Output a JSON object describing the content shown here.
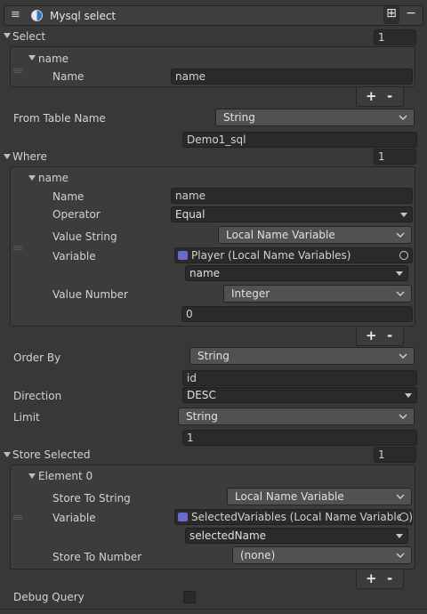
{
  "header": {
    "menu_icon": "≡",
    "title": "Mysql select",
    "add_icon": "⊞",
    "remove_icon": "−"
  },
  "select": {
    "label": "Select",
    "count": "1",
    "item": {
      "header": "name",
      "field_label": "Name",
      "field_value": "name"
    }
  },
  "from_table": {
    "label": "From Table Name",
    "type": "String",
    "value": "Demo1_sql"
  },
  "where": {
    "label": "Where",
    "count": "1",
    "item": {
      "header": "name",
      "name_label": "Name",
      "name_value": "name",
      "operator_label": "Operator",
      "operator_value": "Equal",
      "value_string_label": "Value String",
      "value_string_type": "Local Name Variable",
      "variable_label": "Variable",
      "variable_value": "Player (Local Name Variables)",
      "variable_name": "name",
      "value_number_label": "Value Number",
      "value_number_type": "Integer",
      "value_number_value": "0"
    }
  },
  "order_by": {
    "label": "Order By",
    "type": "String",
    "value": "id"
  },
  "direction": {
    "label": "Direction",
    "value": "DESC"
  },
  "limit": {
    "label": "Limit",
    "type": "String",
    "value": "1"
  },
  "store_selected": {
    "label": "Store Selected",
    "count": "1",
    "item": {
      "header": "Element 0",
      "store_string_label": "Store To String",
      "store_string_type": "Local Name Variable",
      "variable_label": "Variable",
      "variable_value": "SelectedVariables (Local Name Variables)",
      "variable_name": "selectedName",
      "store_number_label": "Store To Number",
      "store_number_value": "(none)"
    }
  },
  "debug": {
    "label": "Debug Query"
  },
  "list_controls": {
    "plus": "+",
    "minus": "-"
  },
  "colors": {
    "background": "#383838",
    "panel": "#3c3c3c",
    "field": "#2a2a2a",
    "popup": "#515151"
  }
}
